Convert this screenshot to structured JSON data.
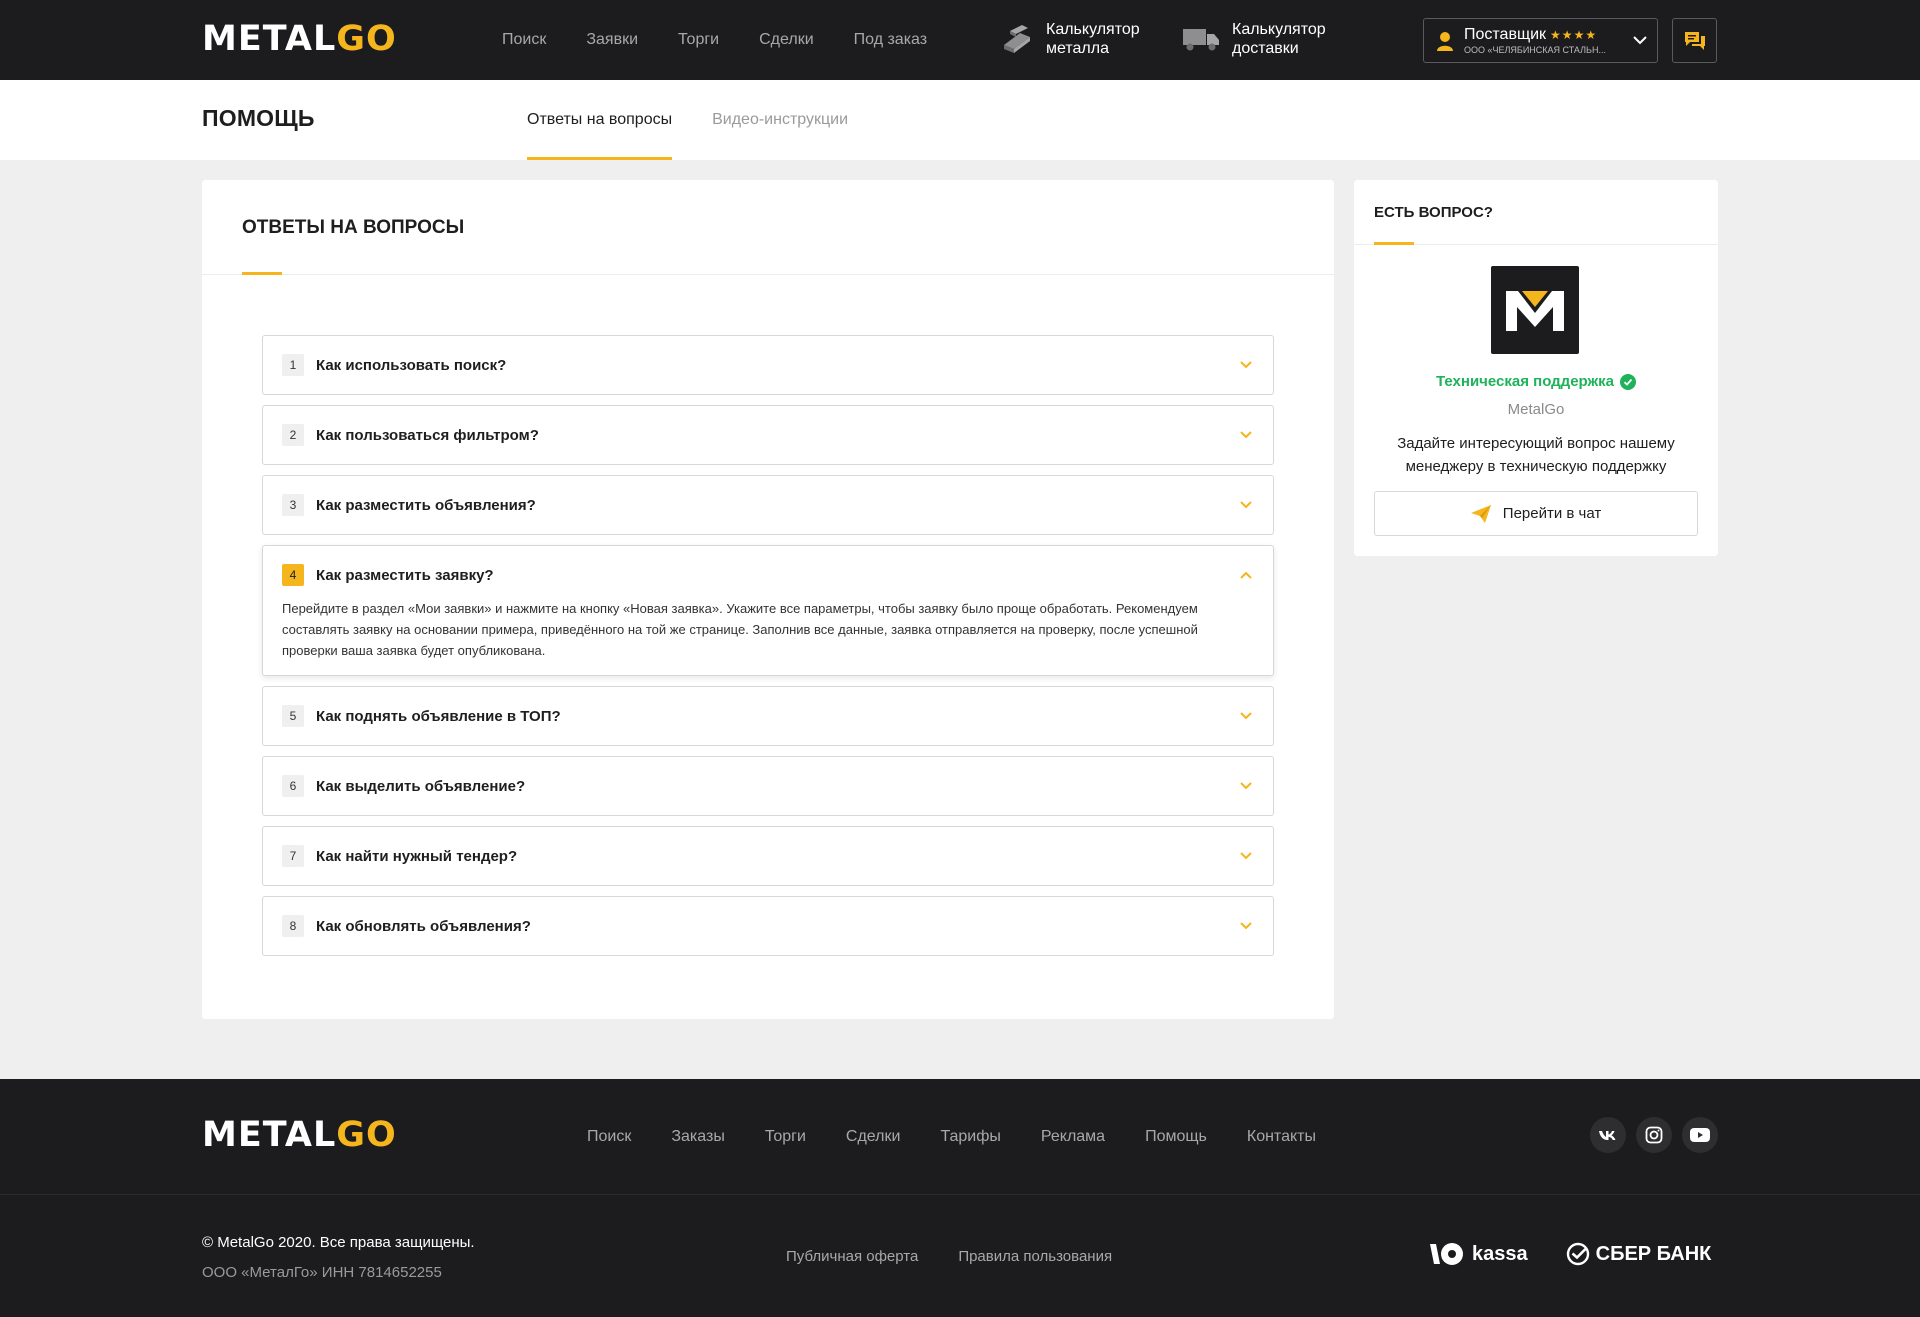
{
  "header": {
    "logo": {
      "part1": "METAL",
      "part2": "GO"
    },
    "nav": [
      "Поиск",
      "Заявки",
      "Торги",
      "Сделки",
      "Под заказ"
    ],
    "calc_metal": {
      "line1": "Калькулятор",
      "line2": "металла"
    },
    "calc_delivery": {
      "line1": "Калькулятор",
      "line2": "доставки"
    },
    "user": {
      "role": "Поставщик",
      "stars": "★★★★",
      "company": "ООО «ЧЕЛЯБИНСКАЯ СТАЛЬН..."
    }
  },
  "subheader": {
    "title": "ПОМОЩЬ",
    "tabs": [
      "Ответы на вопросы",
      "Видео-инструкции"
    ]
  },
  "faq": {
    "title": "ОТВЕТЫ НА ВОПРОСЫ",
    "items": [
      {
        "num": "1",
        "question": "Как использовать поиск?"
      },
      {
        "num": "2",
        "question": "Как пользоваться фильтром?"
      },
      {
        "num": "3",
        "question": "Как разместить объявления?"
      },
      {
        "num": "4",
        "question": "Как разместить заявку?",
        "answer": "Перейдите в раздел «Мои заявки» и нажмите на кнопку «Новая заявка». Укажите все параметры, чтобы заявку было проще обработать. Рекомендуем составлять заявку на основании примера, приведённого на той же странице. Заполнив все данные, заявка отправляется на проверку, после успешной проверки ваша заявка будет опубликована."
      },
      {
        "num": "5",
        "question": "Как поднять объявление в ТОП?"
      },
      {
        "num": "6",
        "question": "Как выделить объявление?"
      },
      {
        "num": "7",
        "question": "Как найти нужный тендер?"
      },
      {
        "num": "8",
        "question": "Как обновлять объявления?"
      }
    ]
  },
  "support": {
    "title": "ЕСТЬ ВОПРОС?",
    "name": "Техническая поддержка",
    "company": "MetalGo",
    "text": "Задайте интересующий вопрос нашему менеджеру в техническую поддержку",
    "button": "Перейти в чат"
  },
  "footer": {
    "logo": {
      "part1": "METAL",
      "part2": "GO"
    },
    "nav": [
      "Поиск",
      "Заказы",
      "Торги",
      "Сделки",
      "Тарифы",
      "Реклама",
      "Помощь",
      "Контакты"
    ],
    "copyright": "© MetalGo 2020. Все права защищены.",
    "legal": "ООО «МеталГо» ИНН 7814652255",
    "links": [
      "Публичная оферта",
      "Правила пользования"
    ],
    "payments": {
      "kassa": "kassa",
      "sber": "СБЕР БАНК"
    }
  },
  "colors": {
    "accent": "#f5b51d",
    "dark": "#1c1c1e",
    "success": "#1fb25a"
  }
}
